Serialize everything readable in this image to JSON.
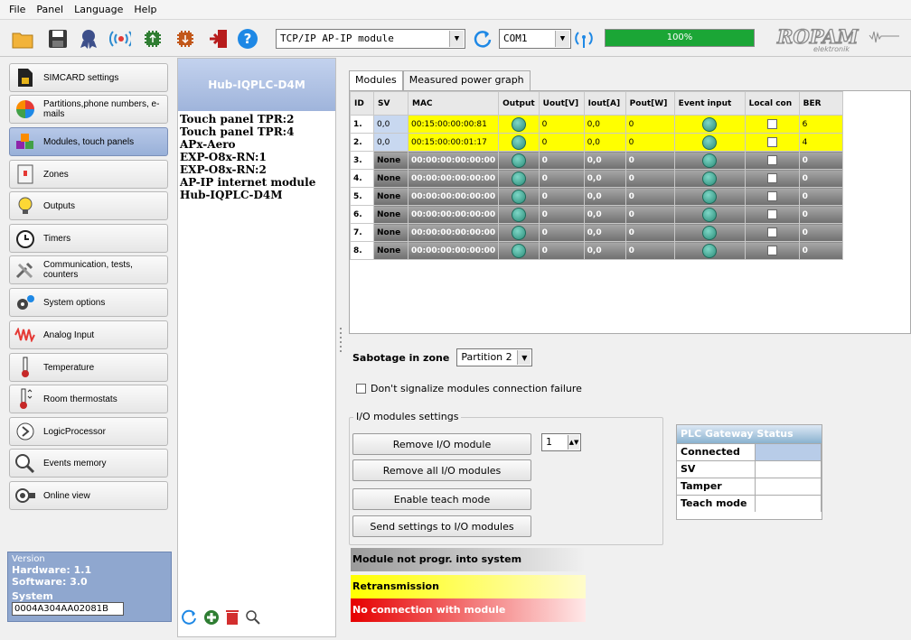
{
  "menu": {
    "file": "File",
    "panel": "Panel",
    "language": "Language",
    "help": "Help"
  },
  "toolbar": {
    "connection_mode": "TCP/IP AP-IP module",
    "port": "COM1",
    "progress_label": "100%",
    "progress_value": 100,
    "logo": "ROPAM elektronik"
  },
  "sidebar": {
    "items": [
      {
        "label": "SIMCARD settings",
        "icon": "simcard-icon"
      },
      {
        "label": "Partitions,phone numbers, e-mails",
        "icon": "partitions-pie-icon"
      },
      {
        "label": "Modules, touch panels",
        "icon": "modules-icon"
      },
      {
        "label": "Zones",
        "icon": "zones-icon"
      },
      {
        "label": "Outputs",
        "icon": "outputs-bulb-icon"
      },
      {
        "label": "Timers",
        "icon": "timer-clock-icon"
      },
      {
        "label": "Communication, tests, counters",
        "icon": "tools-icon"
      },
      {
        "label": "System options",
        "icon": "gears-icon"
      },
      {
        "label": "Analog Input",
        "icon": "analog-wave-icon"
      },
      {
        "label": "Temperature",
        "icon": "thermometer-icon"
      },
      {
        "label": "Room thermostats",
        "icon": "room-thermostat-icon"
      },
      {
        "label": "LogicProcessor",
        "icon": "logic-processor-icon"
      },
      {
        "label": "Events memory",
        "icon": "events-memory-icon"
      },
      {
        "label": "Online view",
        "icon": "online-view-icon"
      }
    ],
    "version": {
      "title": "Version",
      "hardware": "Hardware: 1.1",
      "software": "Software: 3.0",
      "system_label": "System",
      "system_value": "0004A304AA02081B"
    }
  },
  "devices": {
    "header": "Hub-IQPLC-D4M",
    "list": [
      "Touch panel TPR:2",
      "Touch panel TPR:4",
      "APx-Aero",
      "EXP-O8x-RN:1",
      "EXP-O8x-RN:2",
      "AP-IP internet module",
      "Hub-IQPLC-D4M"
    ]
  },
  "main": {
    "tabs": [
      "Modules",
      "Measured power graph"
    ],
    "columns": [
      "ID",
      "SV",
      "MAC",
      "Output",
      "Uout[V]",
      "Iout[A]",
      "Pout[W]",
      "Event input",
      "Local con",
      "BER"
    ],
    "rows": [
      {
        "id": "1.",
        "sv": "0,0",
        "mac": "00:15:00:00:00:81",
        "uout": "0",
        "iout": "0,0",
        "pout": "0",
        "ber": "6",
        "style": "yel"
      },
      {
        "id": "2.",
        "sv": "0,0",
        "mac": "00:15:00:00:01:17",
        "uout": "0",
        "iout": "0,0",
        "pout": "0",
        "ber": "4",
        "style": "yel"
      },
      {
        "id": "3.",
        "sv": "None",
        "mac": "00:00:00:00:00:00",
        "uout": "0",
        "iout": "0,0",
        "pout": "0",
        "ber": "0",
        "style": "gry"
      },
      {
        "id": "4.",
        "sv": "None",
        "mac": "00:00:00:00:00:00",
        "uout": "0",
        "iout": "0,0",
        "pout": "0",
        "ber": "0",
        "style": "gry"
      },
      {
        "id": "5.",
        "sv": "None",
        "mac": "00:00:00:00:00:00",
        "uout": "0",
        "iout": "0,0",
        "pout": "0",
        "ber": "0",
        "style": "gry"
      },
      {
        "id": "6.",
        "sv": "None",
        "mac": "00:00:00:00:00:00",
        "uout": "0",
        "iout": "0,0",
        "pout": "0",
        "ber": "0",
        "style": "gry"
      },
      {
        "id": "7.",
        "sv": "None",
        "mac": "00:00:00:00:00:00",
        "uout": "0",
        "iout": "0,0",
        "pout": "0",
        "ber": "0",
        "style": "gry"
      },
      {
        "id": "8.",
        "sv": "None",
        "mac": "00:00:00:00:00:00",
        "uout": "0",
        "iout": "0,0",
        "pout": "0",
        "ber": "0",
        "style": "gry"
      }
    ],
    "sabotage_label": "Sabotage in zone",
    "sabotage_value": "Partition 2",
    "signalize_label": "Don't signalize modules connection failure",
    "io_group_label": "I/O modules settings",
    "buttons": {
      "remove": "Remove I/O module",
      "remove_all": "Remove all I/O modules",
      "teach": "Enable teach mode",
      "send": "Send settings to I/O modules"
    },
    "module_number": "1",
    "plc": {
      "title": "PLC Gateway Status",
      "rows": [
        "Connected",
        "SV",
        "Tamper",
        "Teach mode"
      ]
    },
    "legend": {
      "not_prog": "Module not progr. into system",
      "retrans": "Retransmission",
      "no_conn": "No connection with module"
    }
  }
}
